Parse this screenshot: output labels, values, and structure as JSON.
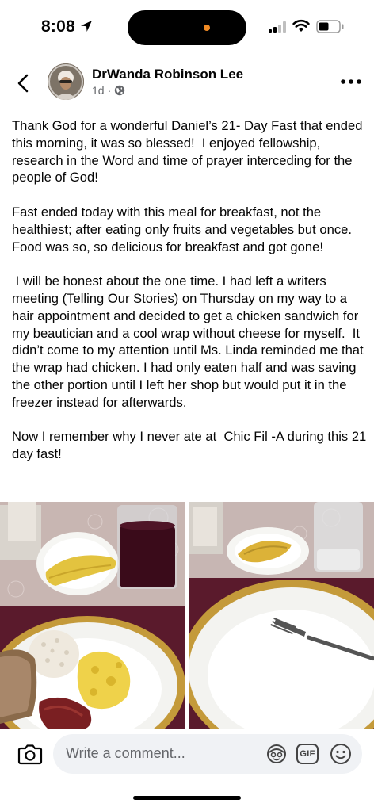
{
  "status_bar": {
    "time": "8:08",
    "icons": [
      "location-arrow-icon",
      "signal-icon",
      "wifi-icon",
      "battery-icon"
    ]
  },
  "post": {
    "author": "DrWanda Robinson Lee",
    "timestamp": "1d",
    "separator": "·",
    "audience_icon": "globe-icon",
    "paragraphs": [
      "Thank God for a wonderful Daniel’s 21- Day Fast that ended this morning, it was so blessed!  I enjoyed fellowship, research in the Word and time of prayer interceding for the people of God!",
      "Fast ended today with this meal for breakfast, not the healthiest; after eating only fruits and vegetables but once. Food was so, so delicious for breakfast and got gone!",
      " I will be honest about the one time. I had left a writers meeting (Telling Our Stories) on Thursday on my way to a hair appointment and decided to get a chicken sandwich for my beautician and a cool wrap without cheese for myself.  It didn’t come to my attention until Ms. Linda reminded me that the wrap had chicken. I had only eaten half and was saving the other portion until I left her shop but would put it in the freezer instead for afterwards.",
      "Now I remember why I never ate at  Chic Fil -A during this 21 day fast!"
    ]
  },
  "comment_bar": {
    "placeholder": "Write a comment...",
    "gif_label": "GIF",
    "icons": [
      "camera-icon",
      "avatar-sticker-icon",
      "gif-icon",
      "emoji-icon"
    ]
  },
  "colors": {
    "text": "#050505",
    "secondary_text": "#65676b",
    "comment_box_bg": "#f0f2f5",
    "notification_dot": "#f08a24"
  }
}
